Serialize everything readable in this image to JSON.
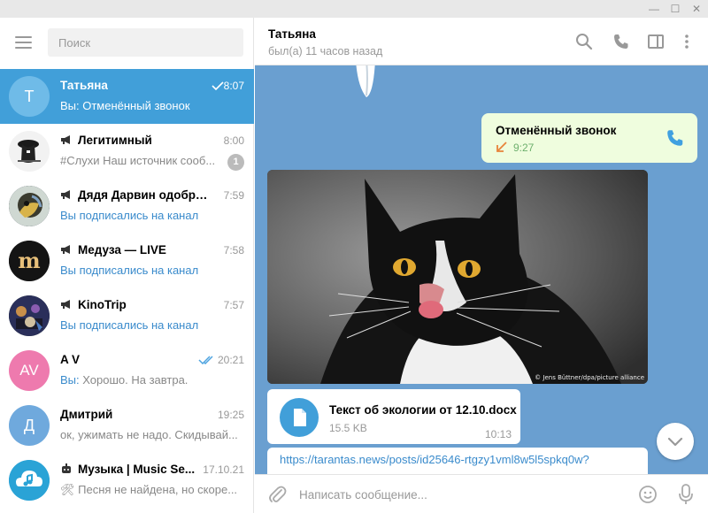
{
  "window": {
    "minimize_glyph": "—",
    "maximize_glyph": "☐",
    "close_glyph": "✕"
  },
  "search": {
    "placeholder": "Поиск"
  },
  "chats": [
    {
      "avatar_letter": "Т",
      "avatar_color": "#6fbbe8",
      "name": "Татьяна",
      "time": "8:07",
      "message": "Вы: Отменённый звонок",
      "active": true,
      "ticks": "single"
    },
    {
      "name": "Легитимный",
      "time": "8:00",
      "message": "#Слухи  Наш источник сооб...",
      "badge": "1",
      "channel": true,
      "avatar_icon": "spy-avatar-icon"
    },
    {
      "name": "Дядя Дарвин одобряе...",
      "time": "7:59",
      "message": "Вы подписались на канал",
      "channel": true,
      "avatar_icon": "darwin-avatar-icon"
    },
    {
      "name": "Медуза — LIVE",
      "time": "7:58",
      "message": "Вы подписались на канал",
      "channel": true,
      "avatar_icon": "meduza-avatar-icon"
    },
    {
      "name": "KinoTrip",
      "time": "7:57",
      "message": "Вы подписались на канал",
      "channel": true,
      "avatar_icon": "kinotrip-avatar-icon"
    },
    {
      "avatar_letter": "AV",
      "avatar_color": "#ee7aae",
      "name": "A V",
      "time": "20:21",
      "message_prefix": "Вы:",
      "message": " Хорошо. На завтра.",
      "ticks": "double"
    },
    {
      "avatar_letter": "Д",
      "avatar_color": "#6fa9dd",
      "name": "Дмитрий",
      "time": "19:25",
      "message": "ок, ужимать не надо. Скидывай..."
    },
    {
      "name": "Музыка | Music Se...",
      "time": "17.10.21",
      "message": "🛠 Песня не найдена, но скоре...",
      "bot": true,
      "avatar_icon": "music-cloud-avatar-icon"
    }
  ],
  "header": {
    "name": "Татьяна",
    "status": "был(а) 11 часов назад"
  },
  "messages": {
    "call": {
      "title": "Отменённый звонок",
      "time": "9:27"
    },
    "photo": {
      "credit": "© Jens Büttner/dpa/picture alliance"
    },
    "file": {
      "name": "Текст об экологии от 12.10.docx",
      "size": "15.5 KB",
      "time": "10:13"
    },
    "link": {
      "url": "https://tarantas.news/posts/id25646-rtgzy1vml8w5l5spkq0w?"
    }
  },
  "composer": {
    "placeholder": "Написать сообщение..."
  },
  "colors": {
    "accent": "#419fd9",
    "chat_bg": "#6a9fd0",
    "outgoing": "#effdde",
    "link": "#3a8bcc"
  }
}
